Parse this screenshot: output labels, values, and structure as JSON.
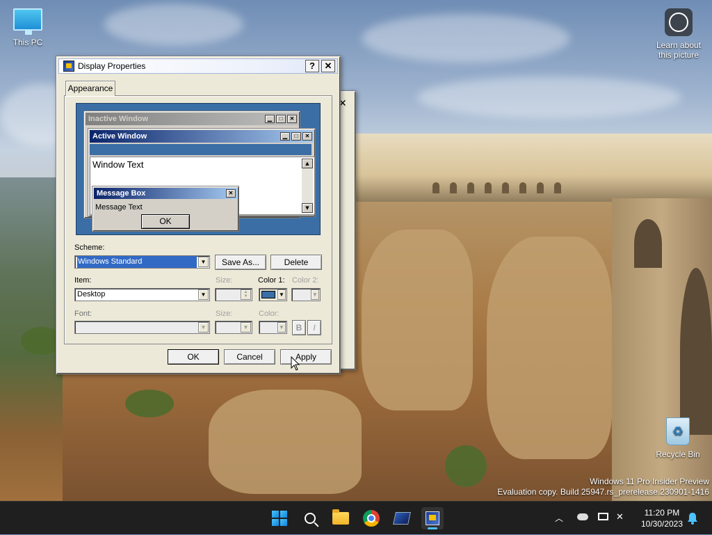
{
  "desktop": {
    "icons": [
      {
        "label": "This PC"
      },
      {
        "label": "Learn about this picture"
      },
      {
        "label": "Recycle Bin"
      }
    ],
    "watermark": {
      "line1": "Windows 11 Pro Insider Preview",
      "line2": "Evaluation copy. Build 25947.rs_prerelease.230901-1416"
    }
  },
  "dialog": {
    "title": "Display Properties",
    "help_label": "?",
    "close_label": "✕",
    "tab_label": "Appearance",
    "preview": {
      "inactive_title": "Inactive Window",
      "active_title": "Active Window",
      "window_text": "Window Text",
      "message_box_title": "Message Box",
      "message_text": "Message Text",
      "ok_label": "OK"
    },
    "scheme": {
      "label": "Scheme:",
      "value": "Windows Standard",
      "save_as_label": "Save As...",
      "delete_label": "Delete"
    },
    "item": {
      "label": "Item:",
      "value": "Desktop",
      "size_label": "Size:",
      "color1_label": "Color 1:",
      "color2_label": "Color 2:",
      "color1_value": "#3a6ea5"
    },
    "font": {
      "label": "Font:",
      "value": "",
      "size_label": "Size:",
      "color_label": "Color:",
      "bold_label": "B",
      "italic_label": "I"
    },
    "buttons": {
      "ok": "OK",
      "cancel": "Cancel",
      "apply": "Apply"
    }
  },
  "taskbar": {
    "icons": [
      "start-icon",
      "search-icon",
      "file-explorer-icon",
      "chrome-icon",
      "control-panel-icon",
      "display-properties-icon"
    ],
    "clock": {
      "time": "11:20 PM",
      "date": "10/30/2023"
    }
  }
}
